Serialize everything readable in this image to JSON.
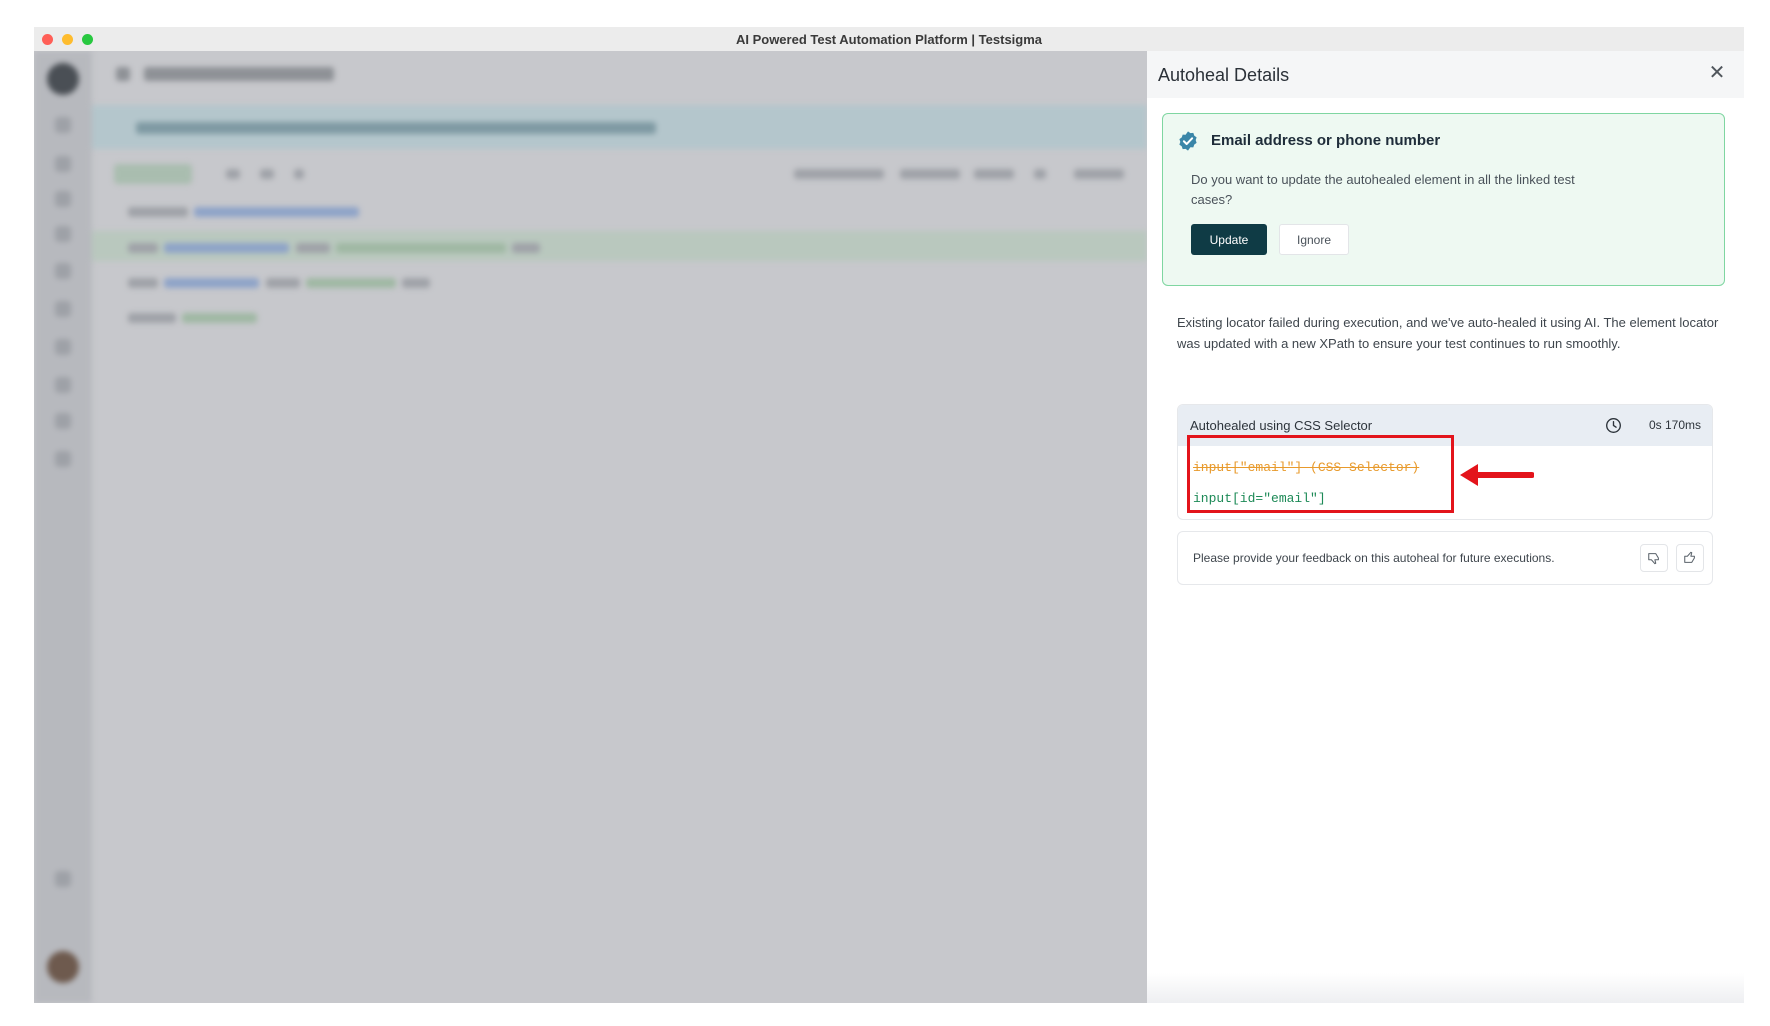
{
  "window": {
    "title": "AI Powered Test Automation Platform | Testsigma"
  },
  "drawer": {
    "title": "Autoheal Details",
    "close_icon": "close-icon",
    "notice": {
      "icon": "verified-badge-icon",
      "title": "Email address or phone number",
      "question": "Do you want to update the autohealed element in all the linked test cases?",
      "update_label": "Update",
      "ignore_label": "Ignore"
    },
    "description": "Existing locator failed during execution, and we've auto-healed it using AI. The element locator was updated with a new XPath to ensure your test continues to run smoothly.",
    "heal": {
      "label": "Autohealed using CSS Selector",
      "time_icon": "clock-icon",
      "time": "0s 170ms",
      "old_locator": "input[\"email\"] (CSS Selector)",
      "new_locator": "input[id=\"email\"]"
    },
    "feedback": {
      "prompt": "Please provide your feedback on this autoheal for future executions.",
      "dislike_icon": "thumbs-down-icon",
      "like_icon": "thumbs-up-icon"
    }
  },
  "colors": {
    "accent": "#0f3b45",
    "success_border": "#7fd6a1",
    "highlight": "#e3141b",
    "old_locator": "#e89a2c",
    "new_locator": "#1d8a57"
  }
}
